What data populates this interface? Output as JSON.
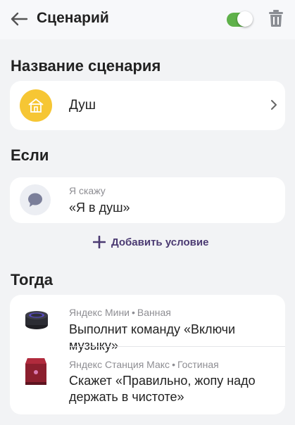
{
  "header": {
    "title": "Сценарий",
    "enabled": true
  },
  "name_section": {
    "title": "Название сценария",
    "scenario_name": "Душ"
  },
  "if_section": {
    "title": "Если",
    "trigger_label": "Я скажу",
    "trigger_phrase": "«Я в душ»",
    "add_condition_label": "Добавить условие"
  },
  "then_section": {
    "title": "Тогда",
    "actions": [
      {
        "device": "Яндекс Мини",
        "room": "Ванная",
        "action": "Выполнит команду «Включи музыку»"
      },
      {
        "device": "Яндекс Станция Макс",
        "room": "Гостиная",
        "action": "Скажет «Правильно, жопу надо держать в чистоте»"
      }
    ]
  },
  "colors": {
    "toggle_on": "#5fb14a",
    "accent": "#4b3a72",
    "home_icon_bg": "#f6c634"
  }
}
